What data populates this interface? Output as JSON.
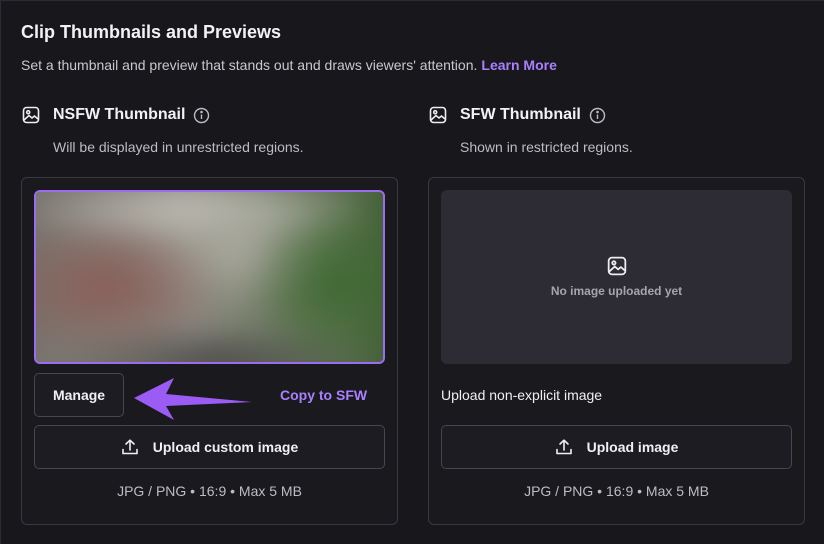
{
  "section": {
    "title": "Clip Thumbnails and Previews",
    "description": "Set a thumbnail and preview that stands out and draws viewers' attention.",
    "learn_more": "Learn More"
  },
  "nsfw": {
    "title": "NSFW Thumbnail",
    "subtitle": "Will be displayed in unrestricted regions.",
    "manage_label": "Manage",
    "copy_label": "Copy to SFW",
    "upload_label": "Upload custom image",
    "hint": "JPG / PNG • 16:9 • Max 5 MB"
  },
  "sfw": {
    "title": "SFW Thumbnail",
    "subtitle": "Shown in restricted regions.",
    "empty_text": "No image uploaded yet",
    "label": "Upload non-explicit image",
    "upload_label": "Upload image",
    "hint": "JPG / PNG • 16:9 • Max 5 MB"
  },
  "colors": {
    "accent": "#a880ff",
    "arrow": "#9b5cf5",
    "background": "#18171c"
  },
  "icons": [
    "image-icon",
    "info-icon",
    "upload-icon",
    "arrow-annotation"
  ]
}
